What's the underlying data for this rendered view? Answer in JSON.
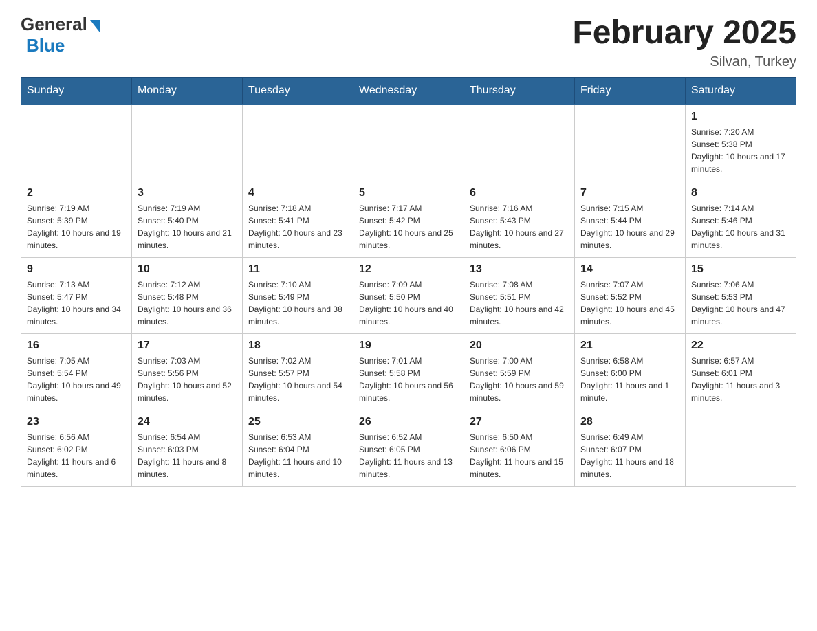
{
  "header": {
    "logo_general": "General",
    "logo_blue": "Blue",
    "title": "February 2025",
    "location": "Silvan, Turkey"
  },
  "weekdays": [
    "Sunday",
    "Monday",
    "Tuesday",
    "Wednesday",
    "Thursday",
    "Friday",
    "Saturday"
  ],
  "weeks": [
    [
      {
        "day": "",
        "info": ""
      },
      {
        "day": "",
        "info": ""
      },
      {
        "day": "",
        "info": ""
      },
      {
        "day": "",
        "info": ""
      },
      {
        "day": "",
        "info": ""
      },
      {
        "day": "",
        "info": ""
      },
      {
        "day": "1",
        "info": "Sunrise: 7:20 AM\nSunset: 5:38 PM\nDaylight: 10 hours and 17 minutes."
      }
    ],
    [
      {
        "day": "2",
        "info": "Sunrise: 7:19 AM\nSunset: 5:39 PM\nDaylight: 10 hours and 19 minutes."
      },
      {
        "day": "3",
        "info": "Sunrise: 7:19 AM\nSunset: 5:40 PM\nDaylight: 10 hours and 21 minutes."
      },
      {
        "day": "4",
        "info": "Sunrise: 7:18 AM\nSunset: 5:41 PM\nDaylight: 10 hours and 23 minutes."
      },
      {
        "day": "5",
        "info": "Sunrise: 7:17 AM\nSunset: 5:42 PM\nDaylight: 10 hours and 25 minutes."
      },
      {
        "day": "6",
        "info": "Sunrise: 7:16 AM\nSunset: 5:43 PM\nDaylight: 10 hours and 27 minutes."
      },
      {
        "day": "7",
        "info": "Sunrise: 7:15 AM\nSunset: 5:44 PM\nDaylight: 10 hours and 29 minutes."
      },
      {
        "day": "8",
        "info": "Sunrise: 7:14 AM\nSunset: 5:46 PM\nDaylight: 10 hours and 31 minutes."
      }
    ],
    [
      {
        "day": "9",
        "info": "Sunrise: 7:13 AM\nSunset: 5:47 PM\nDaylight: 10 hours and 34 minutes."
      },
      {
        "day": "10",
        "info": "Sunrise: 7:12 AM\nSunset: 5:48 PM\nDaylight: 10 hours and 36 minutes."
      },
      {
        "day": "11",
        "info": "Sunrise: 7:10 AM\nSunset: 5:49 PM\nDaylight: 10 hours and 38 minutes."
      },
      {
        "day": "12",
        "info": "Sunrise: 7:09 AM\nSunset: 5:50 PM\nDaylight: 10 hours and 40 minutes."
      },
      {
        "day": "13",
        "info": "Sunrise: 7:08 AM\nSunset: 5:51 PM\nDaylight: 10 hours and 42 minutes."
      },
      {
        "day": "14",
        "info": "Sunrise: 7:07 AM\nSunset: 5:52 PM\nDaylight: 10 hours and 45 minutes."
      },
      {
        "day": "15",
        "info": "Sunrise: 7:06 AM\nSunset: 5:53 PM\nDaylight: 10 hours and 47 minutes."
      }
    ],
    [
      {
        "day": "16",
        "info": "Sunrise: 7:05 AM\nSunset: 5:54 PM\nDaylight: 10 hours and 49 minutes."
      },
      {
        "day": "17",
        "info": "Sunrise: 7:03 AM\nSunset: 5:56 PM\nDaylight: 10 hours and 52 minutes."
      },
      {
        "day": "18",
        "info": "Sunrise: 7:02 AM\nSunset: 5:57 PM\nDaylight: 10 hours and 54 minutes."
      },
      {
        "day": "19",
        "info": "Sunrise: 7:01 AM\nSunset: 5:58 PM\nDaylight: 10 hours and 56 minutes."
      },
      {
        "day": "20",
        "info": "Sunrise: 7:00 AM\nSunset: 5:59 PM\nDaylight: 10 hours and 59 minutes."
      },
      {
        "day": "21",
        "info": "Sunrise: 6:58 AM\nSunset: 6:00 PM\nDaylight: 11 hours and 1 minute."
      },
      {
        "day": "22",
        "info": "Sunrise: 6:57 AM\nSunset: 6:01 PM\nDaylight: 11 hours and 3 minutes."
      }
    ],
    [
      {
        "day": "23",
        "info": "Sunrise: 6:56 AM\nSunset: 6:02 PM\nDaylight: 11 hours and 6 minutes."
      },
      {
        "day": "24",
        "info": "Sunrise: 6:54 AM\nSunset: 6:03 PM\nDaylight: 11 hours and 8 minutes."
      },
      {
        "day": "25",
        "info": "Sunrise: 6:53 AM\nSunset: 6:04 PM\nDaylight: 11 hours and 10 minutes."
      },
      {
        "day": "26",
        "info": "Sunrise: 6:52 AM\nSunset: 6:05 PM\nDaylight: 11 hours and 13 minutes."
      },
      {
        "day": "27",
        "info": "Sunrise: 6:50 AM\nSunset: 6:06 PM\nDaylight: 11 hours and 15 minutes."
      },
      {
        "day": "28",
        "info": "Sunrise: 6:49 AM\nSunset: 6:07 PM\nDaylight: 11 hours and 18 minutes."
      },
      {
        "day": "",
        "info": ""
      }
    ]
  ]
}
